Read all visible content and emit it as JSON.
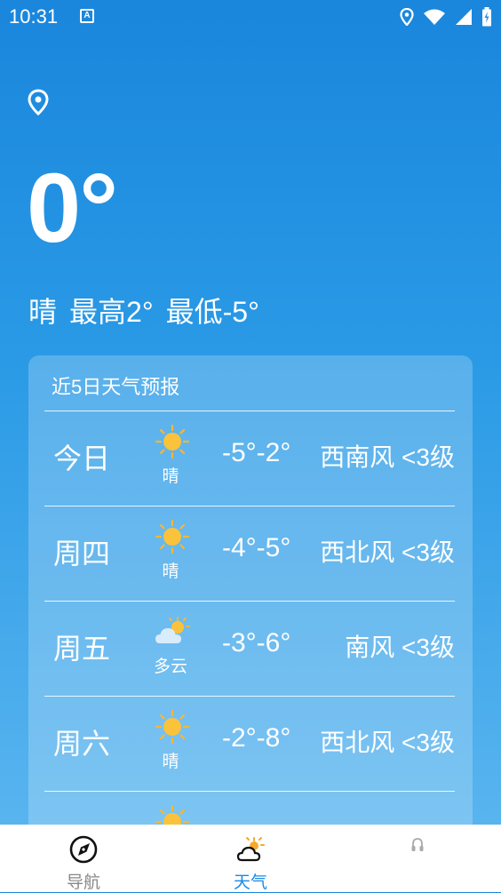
{
  "status_bar": {
    "time": "10:31",
    "notification_icon": "A"
  },
  "weather": {
    "current_temp": "0°",
    "summary": {
      "condition": "晴",
      "high": "最高2°",
      "low": "最低-5°"
    }
  },
  "forecast": {
    "title": "近5日天气预报",
    "rows": [
      {
        "day": "今日",
        "icon": "sun-icon",
        "condition": "晴",
        "temp": "-5°-2°",
        "wind": "西南风 <3级"
      },
      {
        "day": "周四",
        "icon": "sun-icon",
        "condition": "晴",
        "temp": "-4°-5°",
        "wind": "西北风 <3级"
      },
      {
        "day": "周五",
        "icon": "partly-cloudy-icon",
        "condition": "多云",
        "temp": "-3°-6°",
        "wind": "南风 <3级"
      },
      {
        "day": "周六",
        "icon": "sun-icon",
        "condition": "晴",
        "temp": "-2°-8°",
        "wind": "西北风 <3级"
      }
    ]
  },
  "bottom_nav": {
    "items": [
      {
        "label": "导航",
        "icon": "compass-icon",
        "active": false
      },
      {
        "label": "天气",
        "icon": "weather-icon",
        "active": true
      },
      {
        "label": "",
        "icon": "headset-icon",
        "active": false
      }
    ]
  },
  "colors": {
    "accent": "#1a8be6",
    "nav_inactive": "#888888",
    "bg_top": "#1a86dc",
    "bg_bottom": "#5fb8f0"
  }
}
